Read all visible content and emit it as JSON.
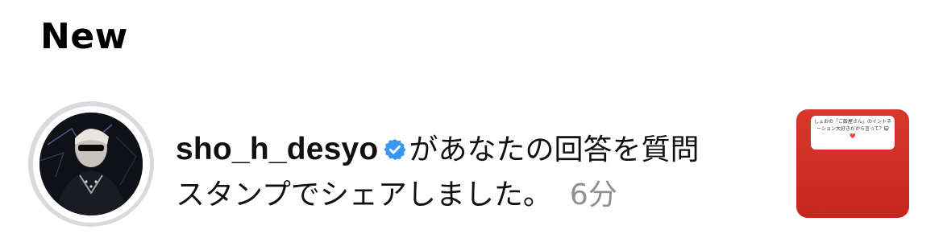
{
  "section": {
    "title": "New"
  },
  "notification": {
    "username": "sho_h_desyo",
    "verified_icon": "verified-badge-icon",
    "message_line1": "があなたの回答を質問",
    "message_line2": "スタンプでシェアしました。",
    "time": "6分",
    "thumbnail": {
      "background_color": "#d32f24",
      "card_text": "しょおの「ご飯屋さん」のイントネーション大好きだから言って？😺❤️"
    }
  },
  "colors": {
    "verified_blue": "#3897f0",
    "timestamp_gray": "#8e8e93",
    "avatar_ring": "#d9dadd"
  }
}
